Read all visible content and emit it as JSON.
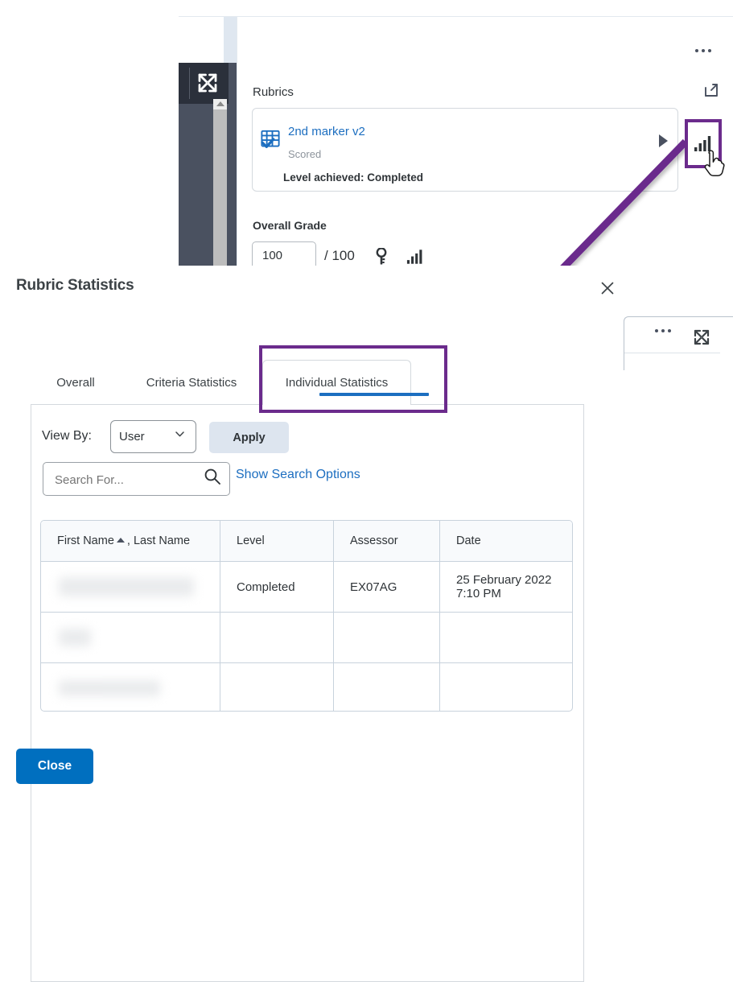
{
  "background_app": {
    "rubrics_label": "Rubrics",
    "popout_icon": "external-link-icon",
    "overflow_icon": "ellipsis-icon",
    "rubric_card": {
      "icon": "rubric-grid-check-icon",
      "name": "2nd marker v2",
      "status": "Scored",
      "level_achieved": "Level achieved: Completed",
      "expand_icon": "triangle-right-icon",
      "statistics_icon": "bar-chart-icon"
    },
    "overall_grade": {
      "label": "Overall Grade",
      "value": "100",
      "denominator": "/ 100",
      "key_icon": "key-icon",
      "chart_icon": "bar-chart-icon"
    },
    "right_panel": {
      "overflow_icon": "ellipsis-icon",
      "expand_icon": "expand-arrows-icon"
    },
    "left_rail": {
      "expand_icon": "expand-arrows-icon"
    }
  },
  "annotation": {
    "highlight_color": "#6b2b8c",
    "arrow": "arrow-pointing-to-individual-statistics-tab",
    "cursor": "pointer-hand-cursor"
  },
  "dialog": {
    "title": "Rubric Statistics",
    "close_icon": "close-x-icon",
    "tabs": [
      {
        "label": "Overall",
        "active": false
      },
      {
        "label": "Criteria Statistics",
        "active": false
      },
      {
        "label": "Individual Statistics",
        "active": true
      }
    ],
    "controls": {
      "view_by_label": "View By:",
      "view_by_value": "User",
      "view_by_options": [
        "User"
      ],
      "chevron_icon": "chevron-down-icon",
      "apply_label": "Apply",
      "search_value": "",
      "search_placeholder": "Search For...",
      "search_icon": "search-icon",
      "show_search_options_label": "Show Search Options"
    },
    "table": {
      "columns": [
        "First Name , Last Name",
        "Level",
        "Assessor",
        "Date"
      ],
      "sort_column": "First Name",
      "sort_direction": "ascending",
      "first_name_label": "First Name",
      "last_name_label": ", Last Name",
      "rows": [
        {
          "name": "",
          "redacted": true,
          "level": "Completed",
          "assessor": "EX07AG",
          "date": "25 February 2022 7:10 PM"
        },
        {
          "name": "",
          "redacted": true,
          "level": "",
          "assessor": "",
          "date": ""
        },
        {
          "name": "",
          "redacted": true,
          "level": "",
          "assessor": "",
          "date": ""
        }
      ]
    },
    "close_button_label": "Close",
    "accent_color": "#006fbf"
  }
}
